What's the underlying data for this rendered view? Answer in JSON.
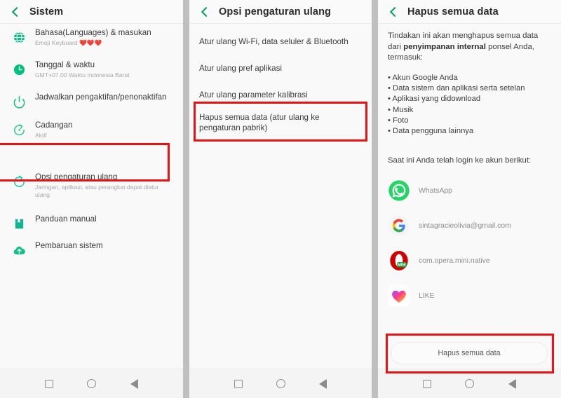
{
  "panel1": {
    "header": {
      "title": "Sistem",
      "back_icon": "back-chevron-icon"
    },
    "items": [
      {
        "title": "Bahasa(Languages) & masukan",
        "subtitle": "Emoji Keyboard ❤️❤️❤️",
        "icon": "globe-icon"
      },
      {
        "title": "Tanggal & waktu",
        "subtitle": "GMT+07.00 Waktu Indonesia Barat",
        "icon": "clock-icon"
      },
      {
        "title": "Jadwalkan pengaktifan/penonaktifan",
        "subtitle": "",
        "icon": "power-icon"
      },
      {
        "title": "Cadangan",
        "subtitle": "Aktif",
        "icon": "backup-icon"
      },
      {
        "title": "Opsi pengaturan ulang",
        "subtitle": "Jaringan, aplikasi, atau perangkat dapat diatur ulang",
        "icon": "reset-icon"
      },
      {
        "title": "Panduan manual",
        "subtitle": "",
        "icon": "book-icon"
      },
      {
        "title": "Pembaruan sistem",
        "subtitle": "",
        "icon": "cloud-upload-icon"
      }
    ],
    "highlight_index": 4
  },
  "panel2": {
    "header": {
      "title": "Opsi pengaturan ulang",
      "back_icon": "back-chevron-icon"
    },
    "items": [
      "Atur ulang Wi-Fi, data seluler & Bluetooth",
      "Atur ulang pref aplikasi",
      "Atur ulang parameter kalibrasi",
      "Hapus semua data (atur ulang ke pengaturan pabrik)"
    ],
    "highlight_index": 3
  },
  "panel3": {
    "header": {
      "title": "Hapus semua data",
      "back_icon": "back-chevron-icon"
    },
    "intro_before": "Tindakan ini akan menghapus semua data dari ",
    "intro_bold": "penyimpanan internal",
    "intro_after": " ponsel Anda, termasuk:",
    "bullets": [
      "Akun Google Anda",
      "Data sistem dan aplikasi serta setelan",
      "Aplikasi yang didownload",
      "Musik",
      "Foto",
      "Data pengguna lainnya"
    ],
    "accounts_heading": "Saat ini Anda telah login ke akun berikut:",
    "accounts": [
      {
        "label": "WhatsApp",
        "icon": "whatsapp-icon"
      },
      {
        "label": "sintagracieolivia@gmail.com",
        "icon": "google-icon"
      },
      {
        "label": "com.opera.mini.native",
        "icon": "opera-mini-icon"
      },
      {
        "label": "LIKE",
        "icon": "like-app-icon"
      }
    ],
    "action_button": "Hapus semua data"
  },
  "navbar": {
    "recent": "recents-square-icon",
    "home": "home-circle-icon",
    "back": "back-triangle-icon"
  },
  "colors": {
    "accent_green": "#00a05a",
    "highlight_red": "#ee1111",
    "panel_bg": "#f9f9f9",
    "divider_gray": "#bfbfbf"
  }
}
